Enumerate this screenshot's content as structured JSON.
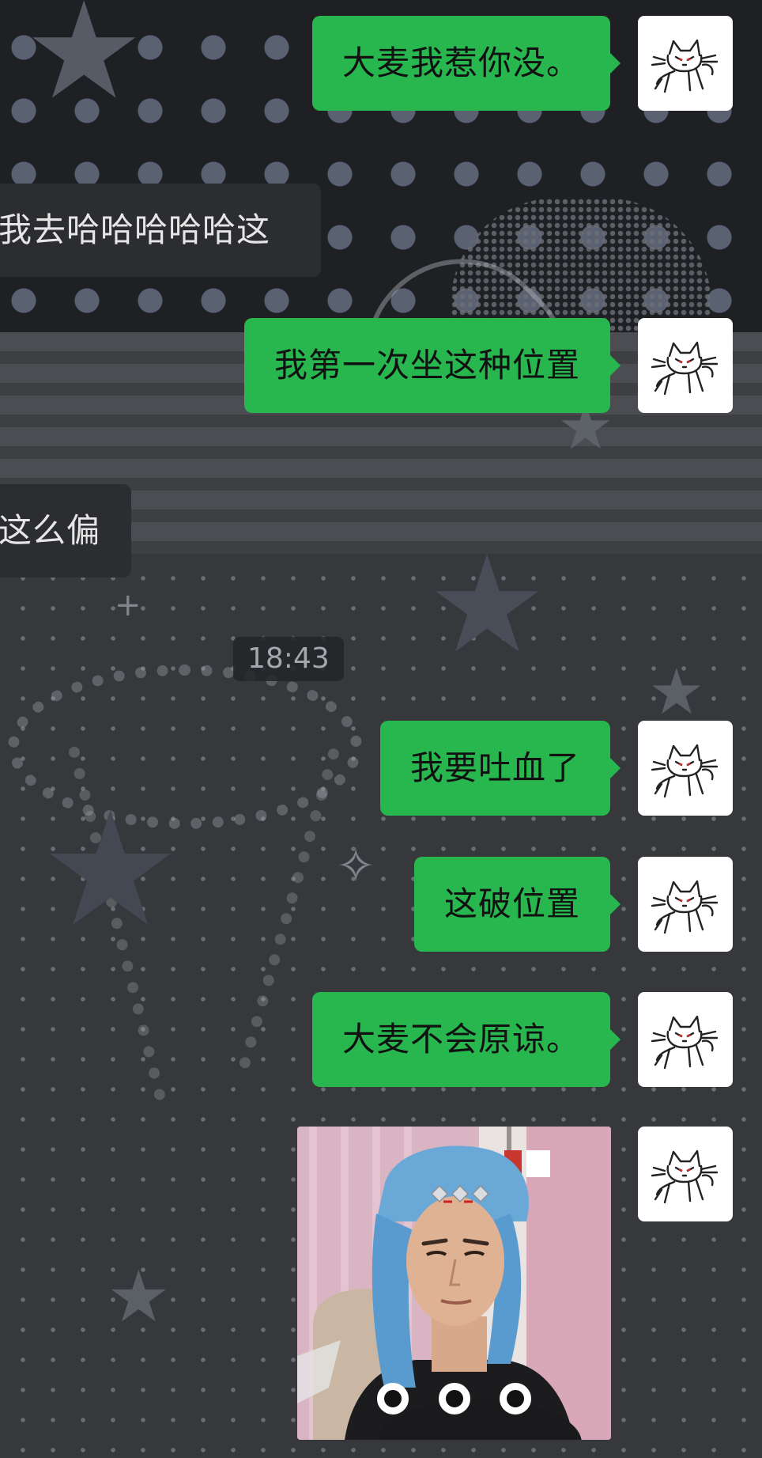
{
  "messages": [
    {
      "id": "m1",
      "side": "out",
      "text": "大麦我惹你没。"
    },
    {
      "id": "m2",
      "side": "in",
      "text": "我去哈哈哈哈哈这"
    },
    {
      "id": "m3",
      "side": "out",
      "text": "我第一次坐这种位置"
    },
    {
      "id": "m4",
      "side": "in",
      "text": "这么偏"
    },
    {
      "id": "m5",
      "side": "out",
      "text": "我要吐血了"
    },
    {
      "id": "m6",
      "side": "out",
      "text": "这破位置"
    },
    {
      "id": "m7",
      "side": "out",
      "text": "大麦不会原谅。"
    }
  ],
  "timestamp": "18:43",
  "image_message": {
    "description_icon": "person-with-blue-headscarf-photo",
    "overlay_icon": "three-dot-loading-icon"
  },
  "avatar_icon": "cat-doodle-avatar-icon",
  "colors": {
    "bubble_out": "#28b64e",
    "bubble_in": "#2c2d30",
    "text_dark": "#111111",
    "text_light": "#e6e6e6",
    "timestamp_text": "#a4a7ad"
  }
}
